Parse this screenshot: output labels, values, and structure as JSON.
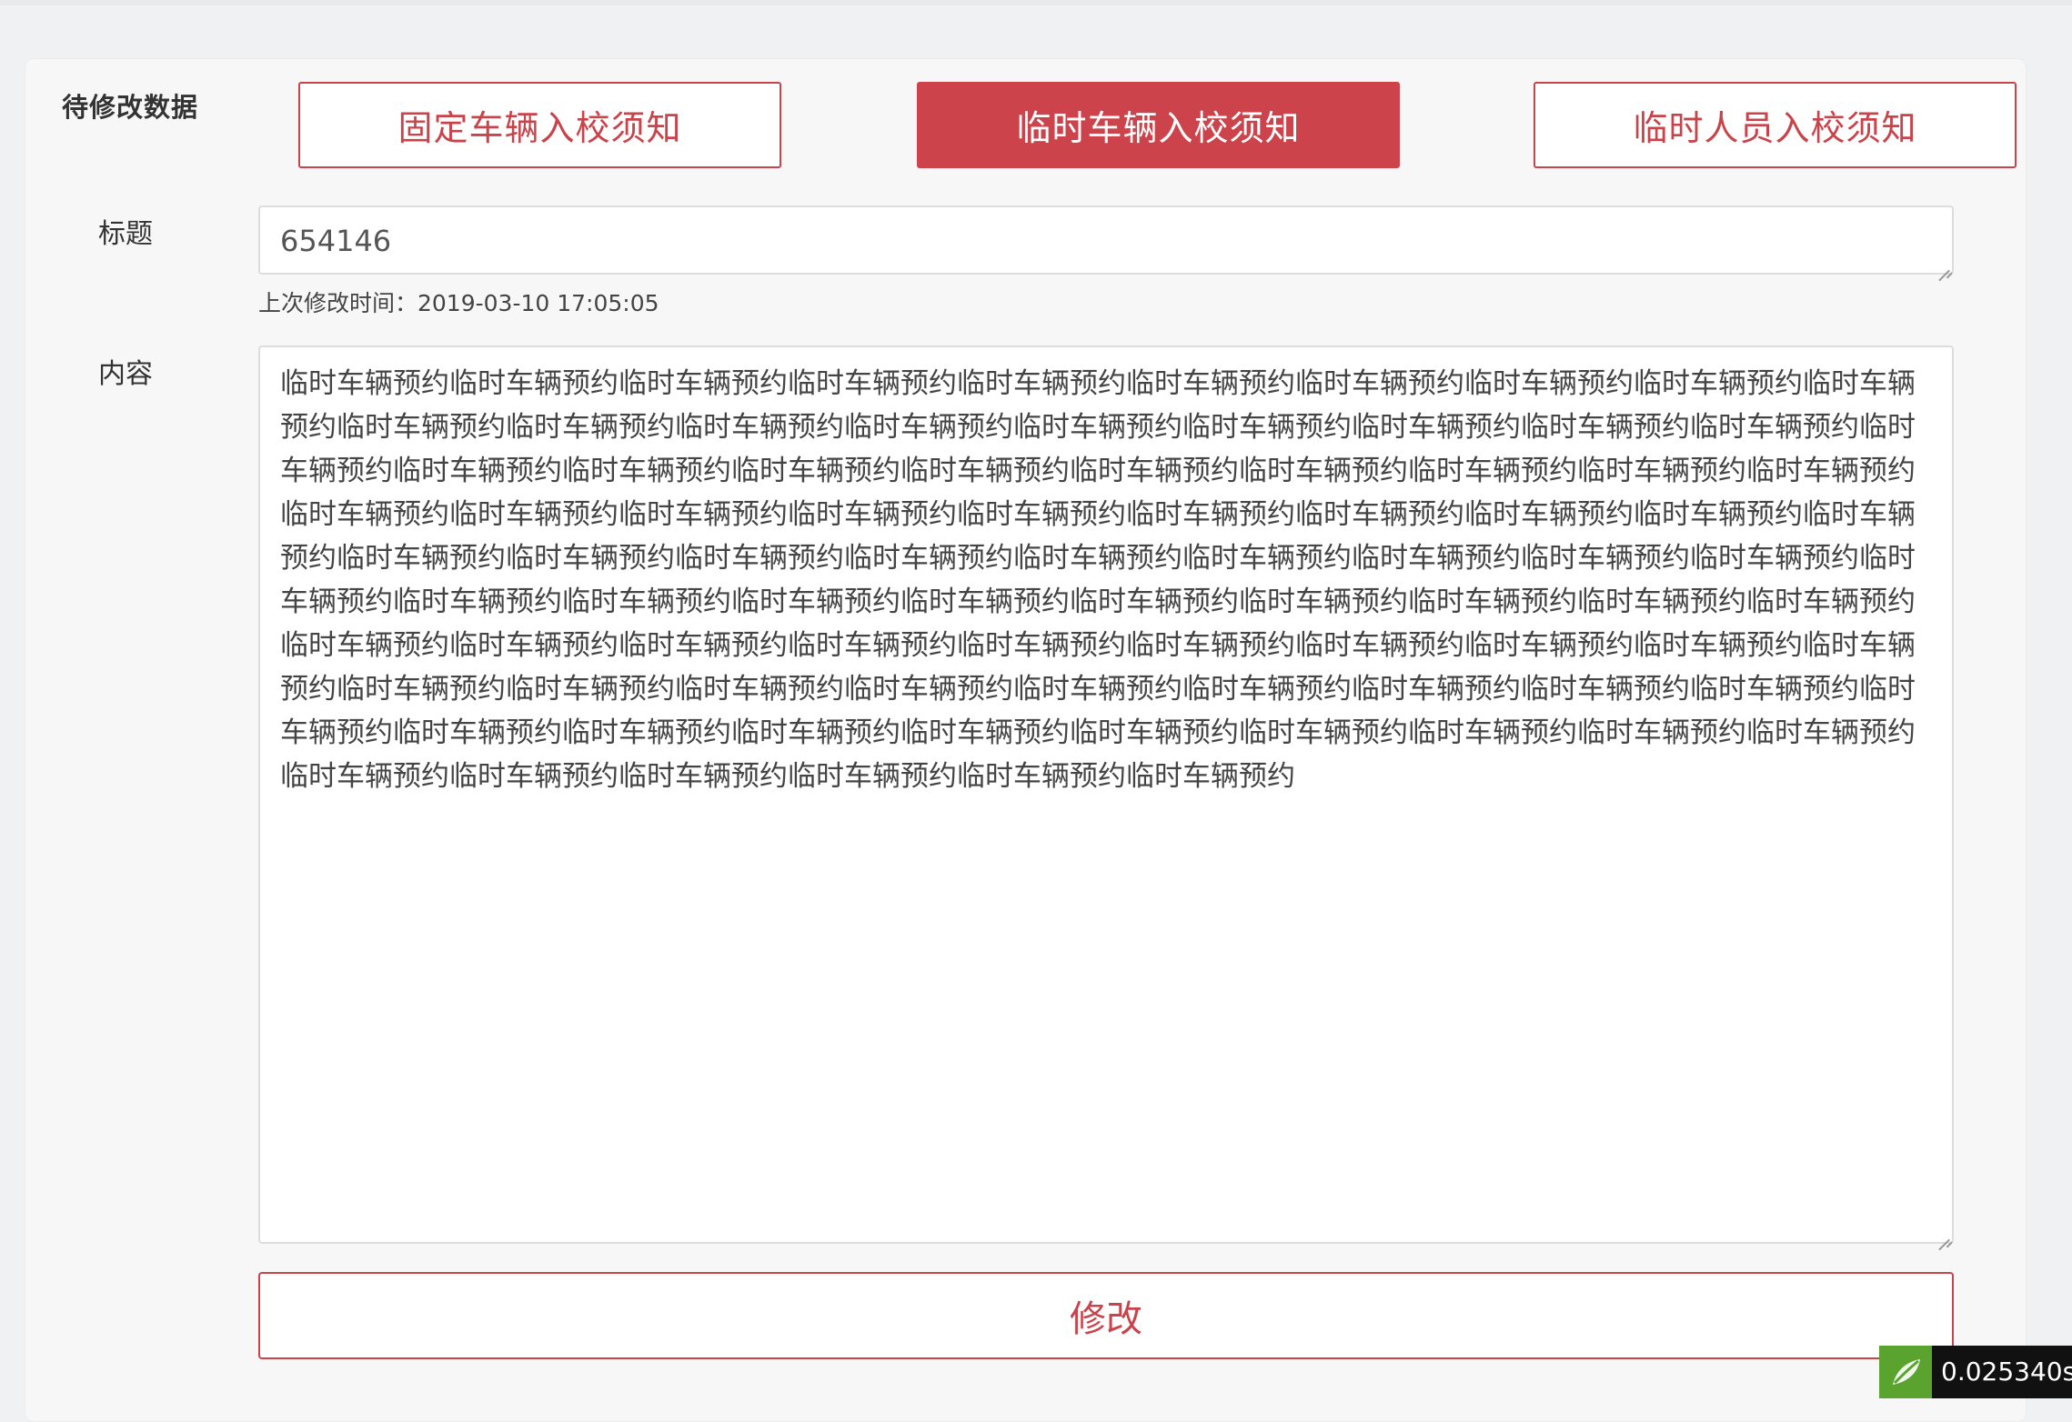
{
  "section": {
    "title": "待修改数据"
  },
  "tabs": [
    {
      "label": "固定车辆入校须知",
      "active": false
    },
    {
      "label": "临时车辆入校须知",
      "active": true
    },
    {
      "label": "临时人员入校须知",
      "active": false
    }
  ],
  "form": {
    "title_label": "标题",
    "title_value": "654146",
    "last_modified": "上次修改时间：2019-03-10 17:05:05",
    "content_label": "内容",
    "content_value": "临时车辆预约临时车辆预约临时车辆预约临时车辆预约临时车辆预约临时车辆预约临时车辆预约临时车辆预约临时车辆预约临时车辆预约临时车辆预约临时车辆预约临时车辆预约临时车辆预约临时车辆预约临时车辆预约临时车辆预约临时车辆预约临时车辆预约临时车辆预约临时车辆预约临时车辆预约临时车辆预约临时车辆预约临时车辆预约临时车辆预约临时车辆预约临时车辆预约临时车辆预约临时车辆预约临时车辆预约临时车辆预约临时车辆预约临时车辆预约临时车辆预约临时车辆预约临时车辆预约临时车辆预约临时车辆预约临时车辆预约临时车辆预约临时车辆预约临时车辆预约临时车辆预约临时车辆预约临时车辆预约临时车辆预约临时车辆预约临时车辆预约临时车辆预约临时车辆预约临时车辆预约临时车辆预约临时车辆预约临时车辆预约临时车辆预约临时车辆预约临时车辆预约临时车辆预约临时车辆预约临时车辆预约临时车辆预约临时车辆预约临时车辆预约临时车辆预约临时车辆预约临时车辆预约临时车辆预约临时车辆预约临时车辆预约临时车辆预约临时车辆预约临时车辆预约临时车辆预约临时车辆预约临时车辆预约临时车辆预约临时车辆预约临时车辆预约临时车辆预约临时车辆预约临时车辆预约临时车辆预约临时车辆预约临时车辆预约临时车辆预约临时车辆预约临时车辆预约临时车辆预约临时车辆预约临时车辆预约临时车辆预约临时车辆预约",
    "submit_label": "修改"
  },
  "debug": {
    "timer": "0.025340s",
    "icon": "leaf-logo-icon"
  },
  "colors": {
    "accent": "#cc434b",
    "background": "#f0f1f3",
    "panel": "#f7f7f7"
  }
}
